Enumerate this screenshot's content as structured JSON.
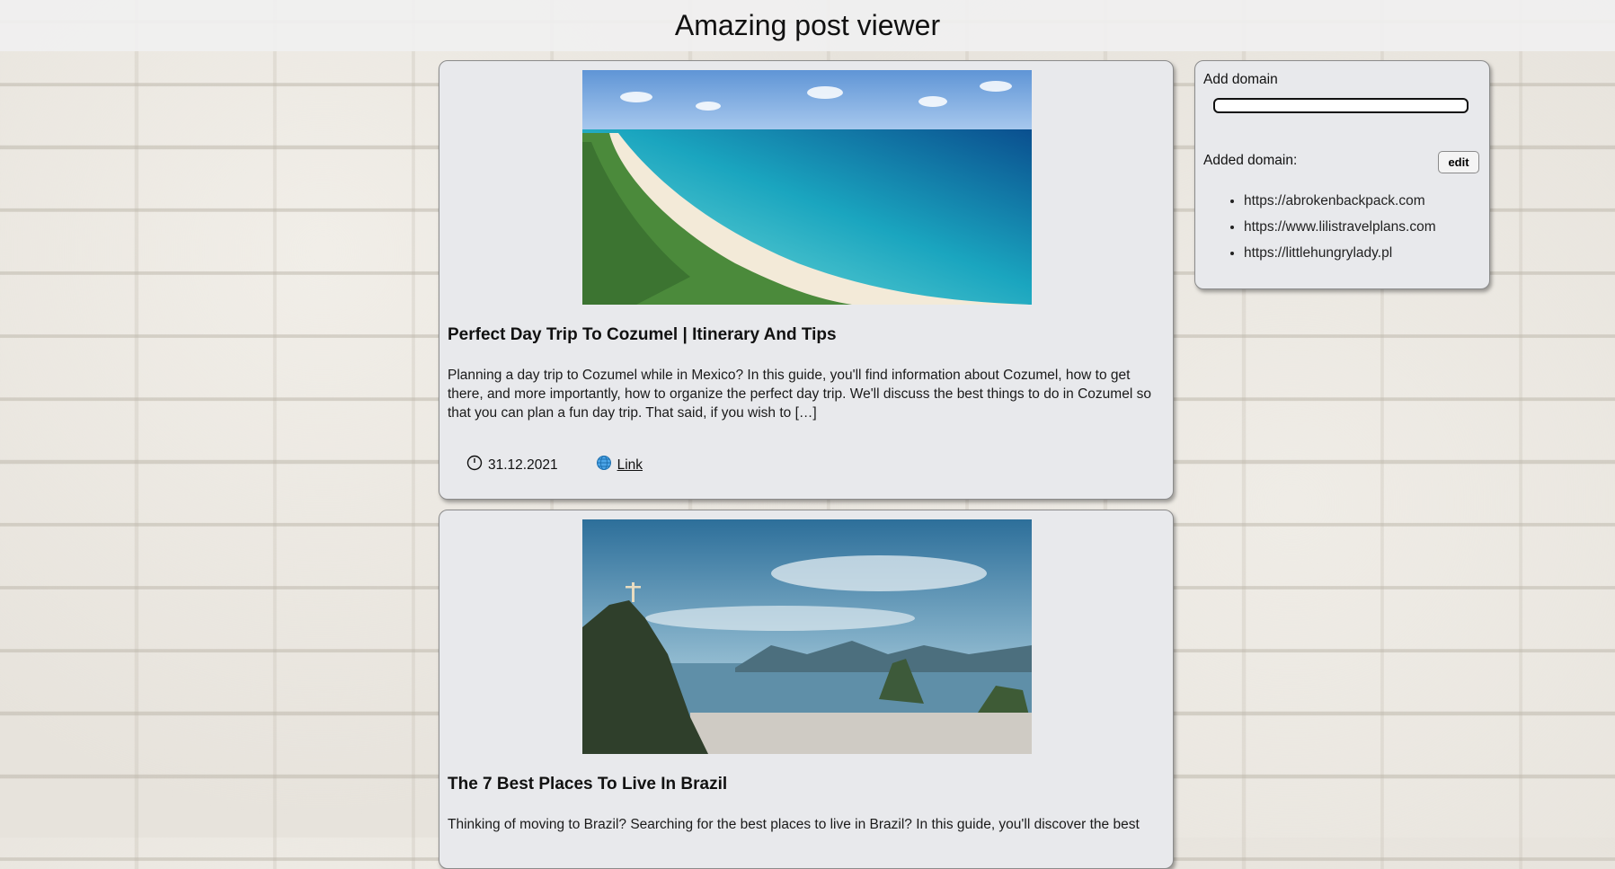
{
  "header": {
    "title": "Amazing post viewer"
  },
  "posts": [
    {
      "title": "Perfect Day Trip To Cozumel | Itinerary And Tips",
      "description": "Planning a day trip to Cozumel while in Mexico? In this guide, you'll find information about Cozumel, how to get there, and more importantly, how to organize the perfect day trip. We'll discuss the best things to do in Cozumel so that you can plan a fun day trip. That said, if you wish to […]",
      "date": "31.12.2021",
      "link_label": "Link",
      "date_icon": "clock-icon",
      "link_icon": "globe-icon"
    },
    {
      "title": "The 7 Best Places To Live In Brazil",
      "description": "Thinking of moving to Brazil? Searching for the best places to live in Brazil? In this guide, you'll discover the best"
    }
  ],
  "sidebar": {
    "add_label": "Add domain",
    "input_value": "",
    "added_label": "Added domain:",
    "edit_label": "edit",
    "domains": [
      "https://abrokenbackpack.com",
      "https://www.lilistravelplans.com",
      "https://littlehungrylady.pl"
    ]
  },
  "colors": {
    "card_bg": "#e8e9ec",
    "topbar_bg": "#f0f0f0",
    "border": "#8b8b8b"
  }
}
